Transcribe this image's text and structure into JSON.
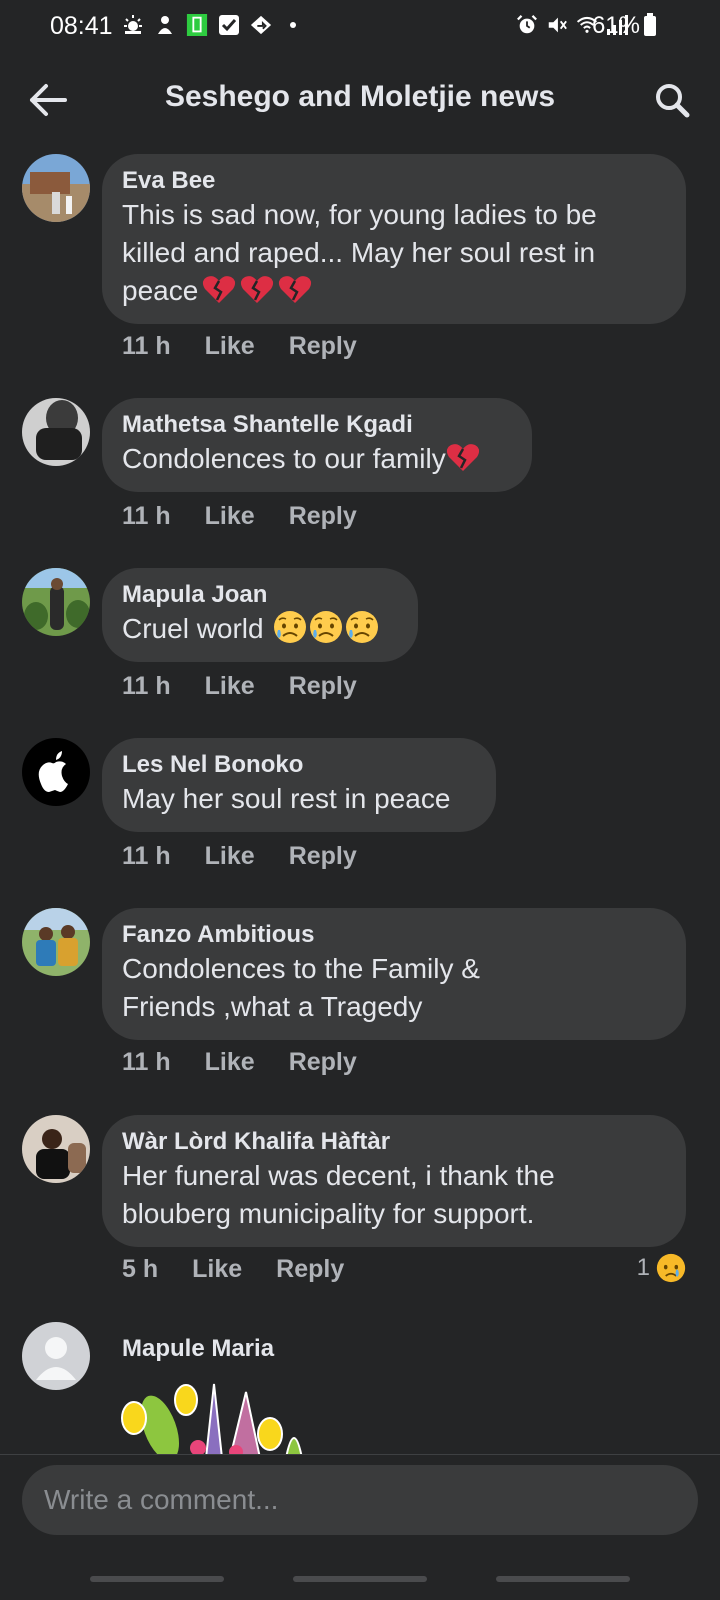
{
  "status_bar": {
    "time": "08:41",
    "battery": "61%",
    "icons_left": [
      "weather-icon",
      "person-hand-icon",
      "battery-saver-icon",
      "check-icon",
      "nav-icon",
      "dot-icon"
    ],
    "icons_right": [
      "alarm-icon",
      "mute-icon",
      "wifi-icon",
      "signal-icon",
      "battery-icon"
    ]
  },
  "header": {
    "title": "Seshego and Moletjie news"
  },
  "comments": [
    {
      "name": "Eva Bee",
      "text": "This is sad now, for young ladies to be killed and raped... May her soul rest in peace",
      "emojis": [
        "broken-heart",
        "broken-heart",
        "broken-heart"
      ],
      "time": "11 h",
      "like": "Like",
      "reply": "Reply"
    },
    {
      "name": "Mathetsa Shantelle Kgadi",
      "text": "Condolences to our family",
      "emojis": [
        "broken-heart"
      ],
      "time": "11 h",
      "like": "Like",
      "reply": "Reply"
    },
    {
      "name": "Mapula Joan",
      "text": "Cruel world",
      "emojis": [
        "sad-sweat-face",
        "sad-sweat-face",
        "sad-sweat-face"
      ],
      "time": "11 h",
      "like": "Like",
      "reply": "Reply"
    },
    {
      "name": "Les Nel Bonoko",
      "text": "May her soul rest in peace",
      "time": "11 h",
      "like": "Like",
      "reply": "Reply"
    },
    {
      "name": "Fanzo Ambitious",
      "text": "Condolences to the Family & Friends ,what a Tragedy",
      "time": "11 h",
      "like": "Like",
      "reply": "Reply"
    },
    {
      "name": "Wàr Lòrd Khalifa Hàftàr",
      "text": "Her funeral was decent, i thank the blouberg municipality for support.",
      "time": "5 h",
      "like": "Like",
      "reply": "Reply",
      "reaction_count": "1",
      "reaction": "sad-face"
    },
    {
      "name": "Mapule Maria",
      "sticker": "flowers-sticker"
    }
  ],
  "composer": {
    "placeholder": "Write a comment..."
  }
}
